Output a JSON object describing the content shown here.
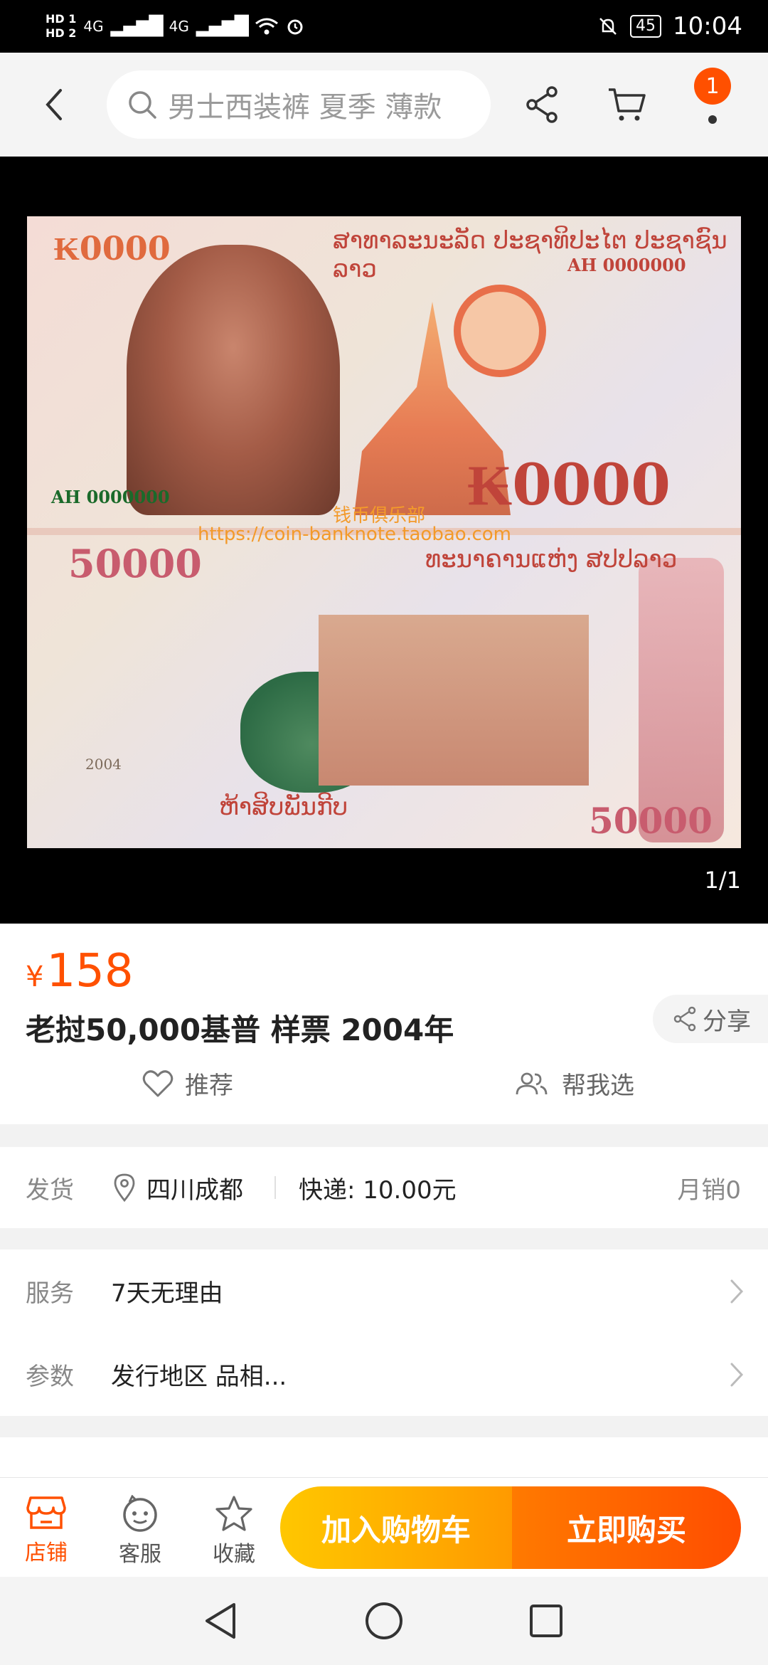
{
  "status_bar": {
    "hd1": "HD 1",
    "hd2": "HD 2",
    "net1": "4G",
    "net2": "4G",
    "battery": "45",
    "time": "10:04"
  },
  "top_nav": {
    "search_placeholder": "男士西装裤 夏季 薄款",
    "cart_badge": "1"
  },
  "gallery": {
    "counter": "1/1",
    "note": {
      "denom_small": "₭0000",
      "denom_big": "₭0000",
      "denom_left": "50000",
      "denom_right": "50000",
      "serial_left": "AH 0000000",
      "serial_right": "AH 0000000",
      "year": "2004",
      "lao_top": "ສາທາລະນະລັດ ປະຊາທິປະໄຕ ປະຊາຊົນລາວ",
      "lao_mid": "ທະນາຄານແຫ່ງ ສປປລາວ",
      "lao_bottom": "ຫ້າສິບພັນກີບ",
      "watermark_cn": "钱币俱乐部",
      "watermark_url": "https://coin-banknote.taobao.com"
    }
  },
  "product": {
    "currency": "¥",
    "price": "158",
    "title": "老挝50,000基普  样票 2004年",
    "share": "分享",
    "recommend": "推荐",
    "help_choose": "帮我选"
  },
  "shipping": {
    "label": "发货",
    "location": "四川成都",
    "fee": "快递: 10.00元",
    "sales": "月销0"
  },
  "service": {
    "label": "服务",
    "value": "7天无理由",
    "param_label": "参数",
    "param_value": "发行地区 品相..."
  },
  "action_bar": {
    "store": "店铺",
    "customer_service": "客服",
    "favorite": "收藏",
    "add_to_cart": "加入购物车",
    "buy_now": "立即购买"
  },
  "colors": {
    "accent": "#ff5000",
    "cart_button": "#ffb300",
    "buy_button": "#ff5a00"
  }
}
